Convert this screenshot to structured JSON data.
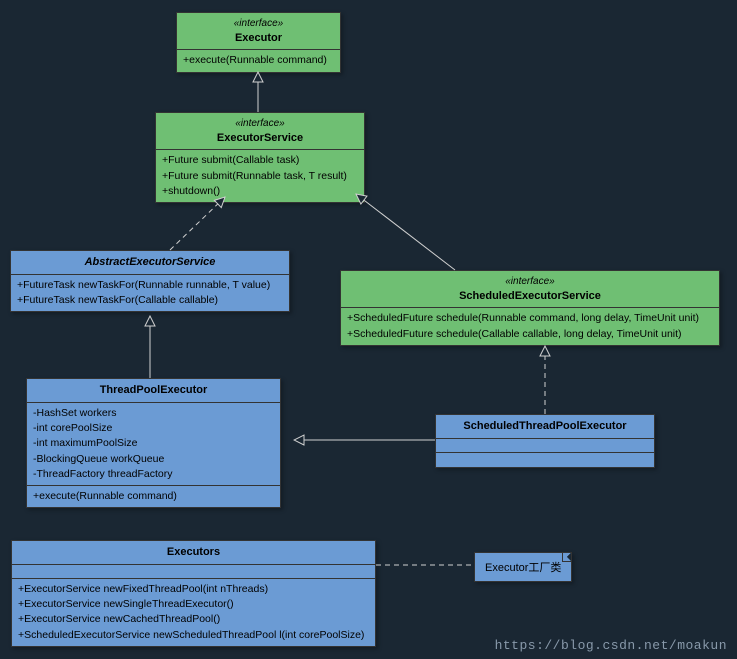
{
  "chart_data": {
    "type": "uml_class_diagram",
    "classes": [
      {
        "id": "Executor",
        "stereotype": "«interface»",
        "kind": "interface",
        "methods": [
          "+execute(Runnable command)"
        ]
      },
      {
        "id": "ExecutorService",
        "stereotype": "«interface»",
        "kind": "interface",
        "methods": [
          "+Future submit(Callable task)",
          "+Future submit(Runnable task, T result)",
          "+shutdown()"
        ]
      },
      {
        "id": "AbstractExecutorService",
        "kind": "abstract_class",
        "methods": [
          "+FutureTask  newTaskFor(Runnable runnable, T value)",
          "+FutureTask  newTaskFor(Callable  callable)"
        ]
      },
      {
        "id": "ScheduledExecutorService",
        "stereotype": "«interface»",
        "kind": "interface",
        "methods": [
          "+ScheduledFuture schedule(Runnable command, long delay, TimeUnit unit)",
          "+ScheduledFuture schedule(Callable callable, long delay, TimeUnit unit)"
        ]
      },
      {
        "id": "ThreadPoolExecutor",
        "kind": "class",
        "fields": [
          "-HashSet  workers",
          "-int  corePoolSize",
          "-int maximumPoolSize",
          "-BlockingQueue workQueue",
          "-ThreadFactory threadFactory"
        ],
        "methods": [
          "+execute(Runnable command)"
        ]
      },
      {
        "id": "ScheduledThreadPoolExecutor",
        "kind": "class"
      },
      {
        "id": "Executors",
        "kind": "class",
        "methods": [
          "+ExecutorService newFixedThreadPool(int nThreads)",
          "+ExecutorService newSingleThreadExecutor()",
          "+ExecutorService newCachedThreadPool()",
          "+ScheduledExecutorService  newScheduledThreadPool l(int corePoolSize)"
        ]
      }
    ],
    "relations": [
      {
        "from": "ExecutorService",
        "to": "Executor",
        "type": "extends"
      },
      {
        "from": "AbstractExecutorService",
        "to": "ExecutorService",
        "type": "implements"
      },
      {
        "from": "ScheduledExecutorService",
        "to": "ExecutorService",
        "type": "extends"
      },
      {
        "from": "ThreadPoolExecutor",
        "to": "AbstractExecutorService",
        "type": "extends"
      },
      {
        "from": "ScheduledThreadPoolExecutor",
        "to": "ThreadPoolExecutor",
        "type": "extends"
      },
      {
        "from": "ScheduledThreadPoolExecutor",
        "to": "ScheduledExecutorService",
        "type": "implements"
      },
      {
        "from": "Executors",
        "to": "note_executor_factory",
        "type": "note_anchor"
      }
    ],
    "notes": [
      {
        "id": "note_executor_factory",
        "text": "Executor工厂类"
      }
    ]
  },
  "boxes": {
    "executor": {
      "stereo": "«interface»",
      "name": "Executor",
      "m0": "+execute(Runnable command)"
    },
    "executorService": {
      "stereo": "«interface»",
      "name": "ExecutorService",
      "m0": "+Future submit(Callable task)",
      "m1": "+Future submit(Runnable task, T result)",
      "m2": "+shutdown()"
    },
    "abstractExecutorService": {
      "name": "AbstractExecutorService",
      "m0": "+FutureTask  newTaskFor(Runnable runnable, T value)",
      "m1": "+FutureTask  newTaskFor(Callable  callable)"
    },
    "scheduledExecutorService": {
      "stereo": "«interface»",
      "name": "ScheduledExecutorService",
      "m0": "+ScheduledFuture schedule(Runnable command, long delay, TimeUnit unit)",
      "m1": "+ScheduledFuture schedule(Callable callable, long delay, TimeUnit unit)"
    },
    "threadPoolExecutor": {
      "name": "ThreadPoolExecutor",
      "f0": "-HashSet  workers",
      "f1": "-int  corePoolSize",
      "f2": "-int maximumPoolSize",
      "f3": "-BlockingQueue workQueue",
      "f4": "-ThreadFactory threadFactory",
      "m0": "+execute(Runnable command)"
    },
    "scheduledThreadPoolExecutor": {
      "name": "ScheduledThreadPoolExecutor"
    },
    "executors": {
      "name": "Executors",
      "m0": "+ExecutorService newFixedThreadPool(int nThreads)",
      "m1": "+ExecutorService newSingleThreadExecutor()",
      "m2": "+ExecutorService newCachedThreadPool()",
      "m3": "+ScheduledExecutorService  newScheduledThreadPool l(int corePoolSize)"
    }
  },
  "note": {
    "text": "Executor工厂类"
  },
  "watermark": "https://blog.csdn.net/moakun"
}
